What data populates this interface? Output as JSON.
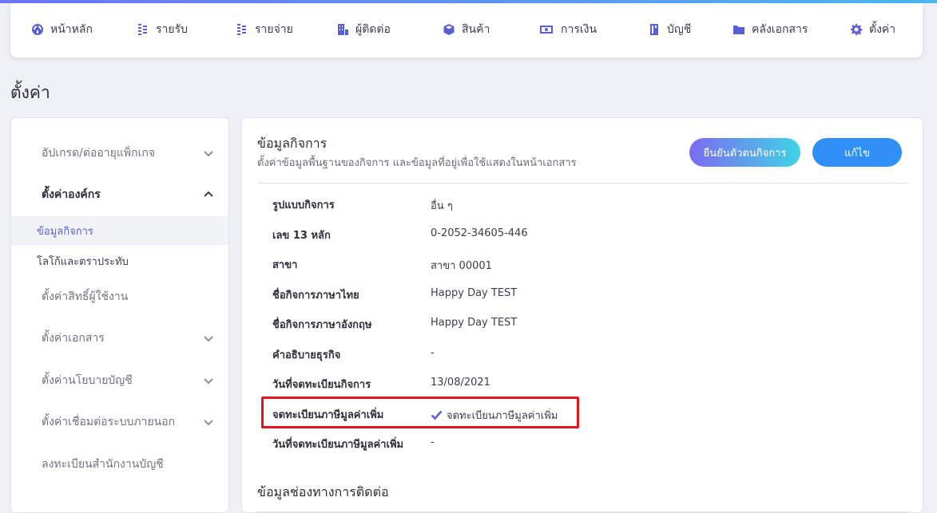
{
  "nav": {
    "items": [
      {
        "label": "หน้าหลัก",
        "icon": "dashboard-icon"
      },
      {
        "label": "รายรับ",
        "icon": "income-coins-icon"
      },
      {
        "label": "รายจ่าย",
        "icon": "expense-coins-icon"
      },
      {
        "label": "ผู้ติดต่อ",
        "icon": "contacts-building-icon"
      },
      {
        "label": "สินค้า",
        "icon": "box-icon"
      },
      {
        "label": "การเงิน",
        "icon": "money-icon"
      },
      {
        "label": "บัญชี",
        "icon": "ledger-icon"
      },
      {
        "label": "คลังเอกสาร",
        "icon": "folder-icon"
      },
      {
        "label": "ตั้งค่า",
        "icon": "gear-icon"
      }
    ]
  },
  "page": {
    "title": "ตั้งค่า"
  },
  "sidebar": {
    "groups": [
      {
        "label": "อัปเกรด/ต่ออายุแพ็กเกจ",
        "state": "collapsed"
      },
      {
        "label": "ตั้งค่าองค์กร",
        "state": "expanded"
      },
      {
        "label": "ตั้งค่าสิทธิ์ผู้ใช้งาน",
        "state": "none"
      },
      {
        "label": "ตั้งค่าเอกสาร",
        "state": "collapsed"
      },
      {
        "label": "ตั้งค่านโยบายบัญชี",
        "state": "collapsed"
      },
      {
        "label": "ตั้งค่าเชื่อมต่อระบบภายนอก",
        "state": "collapsed"
      },
      {
        "label": "ลงทะเบียนสำนักงานบัญชี",
        "state": "none"
      }
    ],
    "subitems": [
      {
        "label": "ข้อมูลกิจการ",
        "active": true
      },
      {
        "label": "โลโก้และตราประทับ",
        "active": false
      }
    ]
  },
  "business_info": {
    "title": "ข้อมูลกิจการ",
    "description": "ตั้งค่าข้อมูลพื้นฐานของกิจการ และข้อมูลที่อยู่เพื่อใช้แสดงในหน้าเอกสาร",
    "verify_button": "ยืนยันตัวตนกิจการ",
    "edit_button": "แก้ไข",
    "rows": [
      {
        "label": "รูปแบบกิจการ",
        "value": "อื่น ๆ"
      },
      {
        "label": "เลข 13 หลัก",
        "value": "0-2052-34605-446"
      },
      {
        "label": "สาขา",
        "value": "สาขา 00001"
      },
      {
        "label": "ชื่อกิจการภาษาไทย",
        "value": "Happy Day TEST"
      },
      {
        "label": "ชื่อกิจการภาษาอังกฤษ",
        "value": "Happy Day TEST"
      },
      {
        "label": "คำอธิบายธุรกิจ",
        "value": "-"
      },
      {
        "label": "วันที่จดทะเบียนกิจการ",
        "value": "13/08/2021"
      },
      {
        "label": "จดทะเบียนภาษีมูลค่าเพิ่ม",
        "value": "จดทะเบียนภาษีมูลค่าเพิ่ม"
      },
      {
        "label": "วันที่จดทะเบียนภาษีมูลค่าเพิ่ม",
        "value": "-"
      }
    ]
  },
  "contact_info": {
    "title": "ข้อมูลช่องทางการติดต่อ"
  },
  "colors": {
    "accent": "#5a5fd6",
    "edit_button": "#2f8ff5",
    "highlight_box": "#e8141c"
  }
}
